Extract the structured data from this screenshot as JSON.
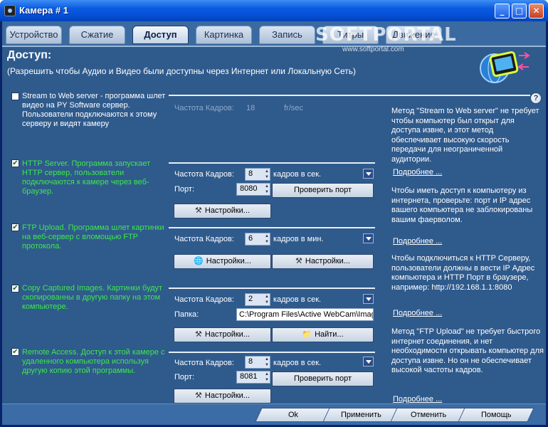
{
  "window": {
    "title": "Камера # 1",
    "min": "_",
    "max": "□",
    "close": "✕"
  },
  "tabs": [
    {
      "label": "Устройство"
    },
    {
      "label": "Сжатие"
    },
    {
      "label": "Доступ"
    },
    {
      "label": "Картинка"
    },
    {
      "label": "Запись"
    },
    {
      "label": "Титры"
    },
    {
      "label": "Движение"
    }
  ],
  "watermark": {
    "brand": "SOFTPORTAL",
    "url": "www.softportal.com"
  },
  "page": {
    "heading": "Доступ:",
    "subheading": "(Разрешить чтобы Аудио и Видео были доступны через Интернет или Локальную Сеть)"
  },
  "sections": {
    "stream": {
      "checked": false,
      "text": "Stream to Web server - программа шлет видео на PY Software сервер. Пользователи подключаются к этому серверу и видят камеру",
      "fps_label": "Частота Кадров:",
      "fps_value": "18",
      "fps_unit": "fr/sec"
    },
    "http": {
      "checked": true,
      "text": "HTTP Server. Программа запускает HTTP сервер, пользователи подключаются к камере через веб-браузер.",
      "fps_label": "Частота Кадров:",
      "fps_value": "8",
      "rate_unit": "кадров в сек.",
      "port_label": "Порт:",
      "port_value": "8080",
      "check_port": "Проверить порт",
      "settings": "Настройки..."
    },
    "ftp": {
      "checked": true,
      "text": "FTP Upload. Программа шлет картинки на веб-сервер с вломощью FTP протокола.",
      "fps_label": "Частота Кадров:",
      "fps_value": "6",
      "rate_unit": "кадров в мин.",
      "settings1": "Настройки...",
      "settings2": "Настройки..."
    },
    "copy": {
      "checked": true,
      "text": "Copy Captured Images. Картинки будут скопированны в другую папку на этом компьютере.",
      "fps_label": "Частота Кадров:",
      "fps_value": "2",
      "rate_unit": "кадров в сек.",
      "folder_label": "Папка:",
      "folder_value": "C:\\Program Files\\Active WebCam\\Imag",
      "settings": "Настройки...",
      "find": "Найти..."
    },
    "remote": {
      "checked": true,
      "text": "Remote Access. Доступ к этой камере с удаленного компьютера используя другую копию этой программы.",
      "fps_label": "Частота Кадров:",
      "fps_value": "8",
      "rate_unit": "кадров в сек.",
      "port_label": "Порт:",
      "port_value": "8081",
      "check_port": "Проверить порт",
      "settings": "Настройки..."
    }
  },
  "help": {
    "icon": "?",
    "info1": "Метод \"Stream to Web server\" не требует чтобы компьютер был открыт для доступа извне, и этот метод обеспечивает высокую скорость передачи для неограниченной аудитории.",
    "more1": "Подробнее ...",
    "info2": "Чтобы иметь доступ к компьютеру из интернета, проверьте: порт и IP адрес вашего компьютера не заблокированы вашим фаерволом.",
    "more2": "Подробнее ...",
    "info3": "Чтобы подключиться к HTTP Серверу, пользователи должны в вести IP Адрес компьютера и HTTP Порт в браузере, например: http://192.168.1.1:8080",
    "more3": "Подробнее ...",
    "info4": "Метод \"FTP Upload\" не требует быстрого интернет соединения, и нет необходимости открывать компьютер для доступа извне. Но он не обеспечивает высокой частоты кадров.",
    "more4": "Подробнее ..."
  },
  "footer": {
    "ok": "Ok",
    "apply": "Применить",
    "cancel": "Отменить",
    "help": "Помощь"
  },
  "icons": {
    "settings": "wrench-icon",
    "globe": "globe-icon",
    "folder": "folder-icon"
  }
}
